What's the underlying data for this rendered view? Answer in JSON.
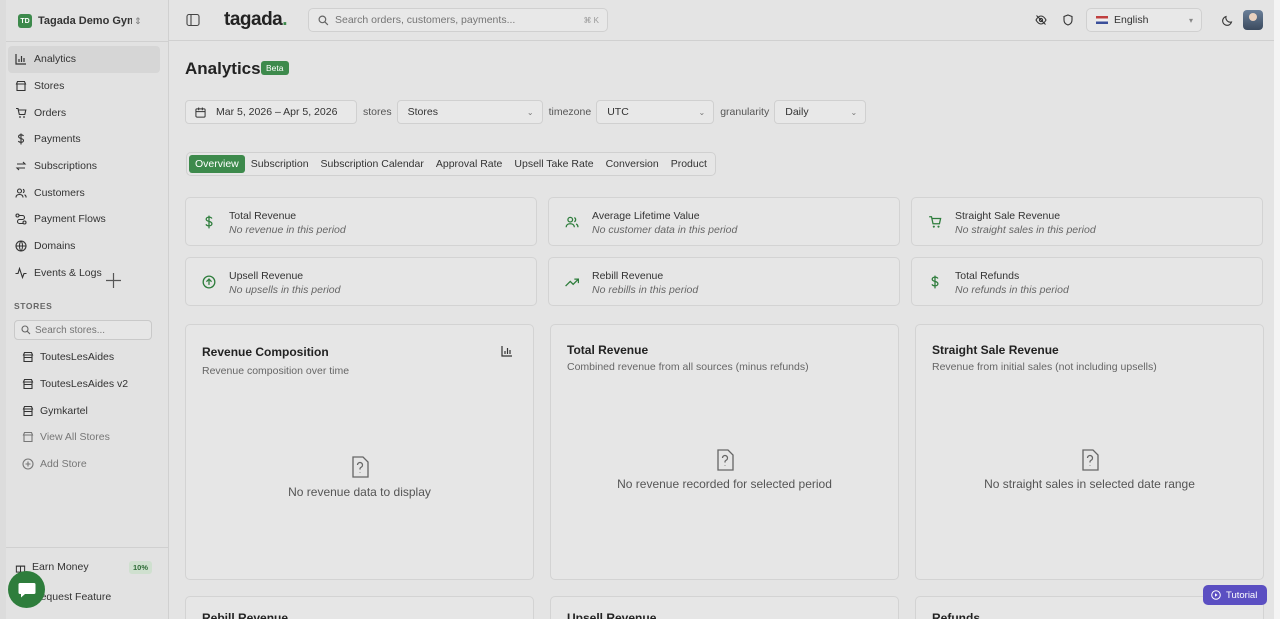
{
  "org": {
    "initials": "TD",
    "name": "Tagada Demo Gym..."
  },
  "nav": [
    {
      "label": "Analytics",
      "icon": "bar-chart-icon",
      "active": true
    },
    {
      "label": "Stores",
      "icon": "store-icon"
    },
    {
      "label": "Orders",
      "icon": "cart-icon"
    },
    {
      "label": "Payments",
      "icon": "dollar-icon"
    },
    {
      "label": "Subscriptions",
      "icon": "refresh-icon"
    },
    {
      "label": "Customers",
      "icon": "users-icon"
    },
    {
      "label": "Payment Flows",
      "icon": "flow-icon"
    },
    {
      "label": "Domains",
      "icon": "globe-icon"
    },
    {
      "label": "Events & Logs",
      "icon": "activity-icon"
    }
  ],
  "stores_section": {
    "label": "STORES",
    "search_placeholder": "Search stores...",
    "items": [
      "ToutesLesAides",
      "ToutesLesAides v2",
      "Gymkartel"
    ],
    "view_all": "View All Stores",
    "add": "Add Store"
  },
  "bottom": {
    "earn": "Earn Money",
    "earn_badge": "10%",
    "request": "Request Feature"
  },
  "header": {
    "logo": "tagada",
    "logo_dot": ".",
    "search_placeholder": "Search orders, customers, payments...",
    "shortcut": "⌘ K",
    "language": "English"
  },
  "page": {
    "title": "Analytics",
    "badge": "Beta",
    "date_range": "Mar 5, 2026 – Apr 5, 2026",
    "stores_label": "stores",
    "stores_value": "Stores",
    "timezone_label": "timezone",
    "timezone_value": "UTC",
    "granularity_label": "granularity",
    "granularity_value": "Daily"
  },
  "tabs": [
    "Overview",
    "Subscription",
    "Subscription Calendar",
    "Approval Rate",
    "Upsell Take Rate",
    "Conversion",
    "Product"
  ],
  "kpis": [
    {
      "title": "Total Revenue",
      "sub": "No revenue in this period",
      "icon": "dollar-icon"
    },
    {
      "title": "Average Lifetime Value",
      "sub": "No customer data in this period",
      "icon": "users-icon"
    },
    {
      "title": "Straight Sale Revenue",
      "sub": "No straight sales in this period",
      "icon": "cart-icon"
    },
    {
      "title": "Upsell Revenue",
      "sub": "No upsells in this period",
      "icon": "arrow-up-circle-icon"
    },
    {
      "title": "Rebill Revenue",
      "sub": "No rebills in this period",
      "icon": "trending-up-icon"
    },
    {
      "title": "Total Refunds",
      "sub": "No refunds in this period",
      "icon": "dollar-icon"
    }
  ],
  "cards": [
    {
      "title": "Revenue Composition",
      "sub": "Revenue composition over time",
      "empty": "No revenue data to display"
    },
    {
      "title": "Total Revenue",
      "sub": "Combined revenue from all sources (minus refunds)",
      "empty": "No revenue recorded for selected period"
    },
    {
      "title": "Straight Sale Revenue",
      "sub": "Revenue from initial sales (not including upsells)",
      "empty": "No straight sales in selected date range"
    }
  ],
  "lower_cards": [
    "Rebill Revenue",
    "Upsell Revenue",
    "Refunds"
  ],
  "tutorial": "Tutorial",
  "colors": {
    "accent": "#3d8a4c",
    "tutorial": "#5b4fc2"
  }
}
